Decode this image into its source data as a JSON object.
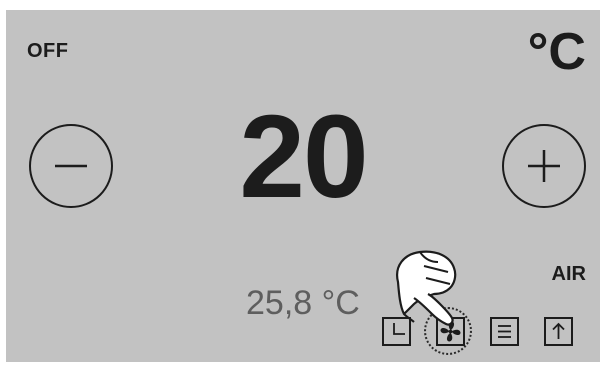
{
  "thermostat": {
    "power_state": "OFF",
    "unit": "°C",
    "setpoint": "20",
    "current_temperature": "25,8 °C",
    "mode": "AIR"
  },
  "controls": {
    "decrease_icon": "minus-icon",
    "increase_icon": "plus-icon",
    "mode_buttons": [
      {
        "icon": "timer-icon"
      },
      {
        "icon": "fan-icon",
        "active": true
      },
      {
        "icon": "menu-icon"
      },
      {
        "icon": "arrow-up-icon"
      }
    ]
  },
  "overlay": {
    "icon": "pointing-hand-icon"
  },
  "colors": {
    "panel_background": "#c2c2c2",
    "text_primary": "#1c1c1c",
    "text_secondary": "#5e5e5e"
  }
}
